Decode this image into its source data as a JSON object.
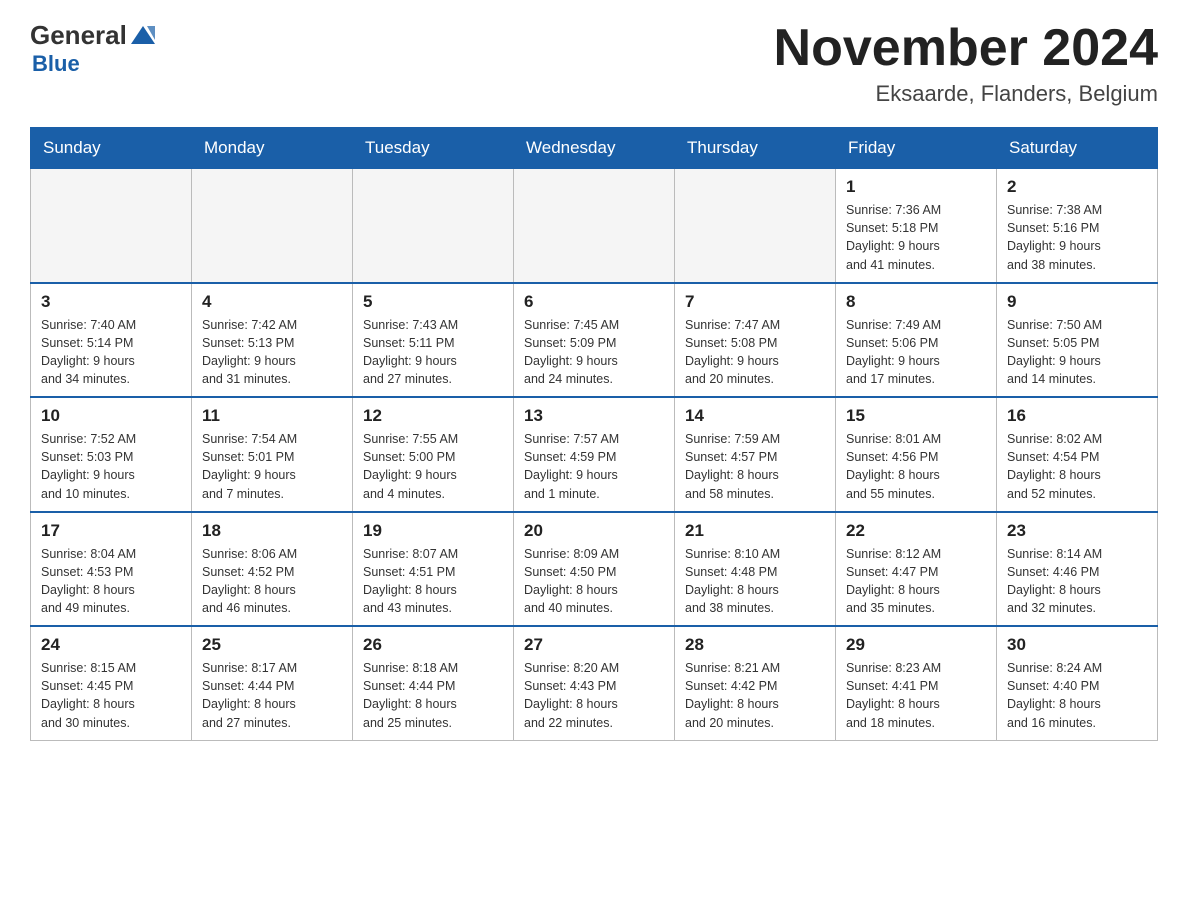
{
  "header": {
    "logo_general": "General",
    "logo_blue": "Blue",
    "month_title": "November 2024",
    "location": "Eksaarde, Flanders, Belgium"
  },
  "weekdays": [
    "Sunday",
    "Monday",
    "Tuesday",
    "Wednesday",
    "Thursday",
    "Friday",
    "Saturday"
  ],
  "weeks": [
    [
      {
        "day": "",
        "info": ""
      },
      {
        "day": "",
        "info": ""
      },
      {
        "day": "",
        "info": ""
      },
      {
        "day": "",
        "info": ""
      },
      {
        "day": "",
        "info": ""
      },
      {
        "day": "1",
        "info": "Sunrise: 7:36 AM\nSunset: 5:18 PM\nDaylight: 9 hours\nand 41 minutes."
      },
      {
        "day": "2",
        "info": "Sunrise: 7:38 AM\nSunset: 5:16 PM\nDaylight: 9 hours\nand 38 minutes."
      }
    ],
    [
      {
        "day": "3",
        "info": "Sunrise: 7:40 AM\nSunset: 5:14 PM\nDaylight: 9 hours\nand 34 minutes."
      },
      {
        "day": "4",
        "info": "Sunrise: 7:42 AM\nSunset: 5:13 PM\nDaylight: 9 hours\nand 31 minutes."
      },
      {
        "day": "5",
        "info": "Sunrise: 7:43 AM\nSunset: 5:11 PM\nDaylight: 9 hours\nand 27 minutes."
      },
      {
        "day": "6",
        "info": "Sunrise: 7:45 AM\nSunset: 5:09 PM\nDaylight: 9 hours\nand 24 minutes."
      },
      {
        "day": "7",
        "info": "Sunrise: 7:47 AM\nSunset: 5:08 PM\nDaylight: 9 hours\nand 20 minutes."
      },
      {
        "day": "8",
        "info": "Sunrise: 7:49 AM\nSunset: 5:06 PM\nDaylight: 9 hours\nand 17 minutes."
      },
      {
        "day": "9",
        "info": "Sunrise: 7:50 AM\nSunset: 5:05 PM\nDaylight: 9 hours\nand 14 minutes."
      }
    ],
    [
      {
        "day": "10",
        "info": "Sunrise: 7:52 AM\nSunset: 5:03 PM\nDaylight: 9 hours\nand 10 minutes."
      },
      {
        "day": "11",
        "info": "Sunrise: 7:54 AM\nSunset: 5:01 PM\nDaylight: 9 hours\nand 7 minutes."
      },
      {
        "day": "12",
        "info": "Sunrise: 7:55 AM\nSunset: 5:00 PM\nDaylight: 9 hours\nand 4 minutes."
      },
      {
        "day": "13",
        "info": "Sunrise: 7:57 AM\nSunset: 4:59 PM\nDaylight: 9 hours\nand 1 minute."
      },
      {
        "day": "14",
        "info": "Sunrise: 7:59 AM\nSunset: 4:57 PM\nDaylight: 8 hours\nand 58 minutes."
      },
      {
        "day": "15",
        "info": "Sunrise: 8:01 AM\nSunset: 4:56 PM\nDaylight: 8 hours\nand 55 minutes."
      },
      {
        "day": "16",
        "info": "Sunrise: 8:02 AM\nSunset: 4:54 PM\nDaylight: 8 hours\nand 52 minutes."
      }
    ],
    [
      {
        "day": "17",
        "info": "Sunrise: 8:04 AM\nSunset: 4:53 PM\nDaylight: 8 hours\nand 49 minutes."
      },
      {
        "day": "18",
        "info": "Sunrise: 8:06 AM\nSunset: 4:52 PM\nDaylight: 8 hours\nand 46 minutes."
      },
      {
        "day": "19",
        "info": "Sunrise: 8:07 AM\nSunset: 4:51 PM\nDaylight: 8 hours\nand 43 minutes."
      },
      {
        "day": "20",
        "info": "Sunrise: 8:09 AM\nSunset: 4:50 PM\nDaylight: 8 hours\nand 40 minutes."
      },
      {
        "day": "21",
        "info": "Sunrise: 8:10 AM\nSunset: 4:48 PM\nDaylight: 8 hours\nand 38 minutes."
      },
      {
        "day": "22",
        "info": "Sunrise: 8:12 AM\nSunset: 4:47 PM\nDaylight: 8 hours\nand 35 minutes."
      },
      {
        "day": "23",
        "info": "Sunrise: 8:14 AM\nSunset: 4:46 PM\nDaylight: 8 hours\nand 32 minutes."
      }
    ],
    [
      {
        "day": "24",
        "info": "Sunrise: 8:15 AM\nSunset: 4:45 PM\nDaylight: 8 hours\nand 30 minutes."
      },
      {
        "day": "25",
        "info": "Sunrise: 8:17 AM\nSunset: 4:44 PM\nDaylight: 8 hours\nand 27 minutes."
      },
      {
        "day": "26",
        "info": "Sunrise: 8:18 AM\nSunset: 4:44 PM\nDaylight: 8 hours\nand 25 minutes."
      },
      {
        "day": "27",
        "info": "Sunrise: 8:20 AM\nSunset: 4:43 PM\nDaylight: 8 hours\nand 22 minutes."
      },
      {
        "day": "28",
        "info": "Sunrise: 8:21 AM\nSunset: 4:42 PM\nDaylight: 8 hours\nand 20 minutes."
      },
      {
        "day": "29",
        "info": "Sunrise: 8:23 AM\nSunset: 4:41 PM\nDaylight: 8 hours\nand 18 minutes."
      },
      {
        "day": "30",
        "info": "Sunrise: 8:24 AM\nSunset: 4:40 PM\nDaylight: 8 hours\nand 16 minutes."
      }
    ]
  ]
}
